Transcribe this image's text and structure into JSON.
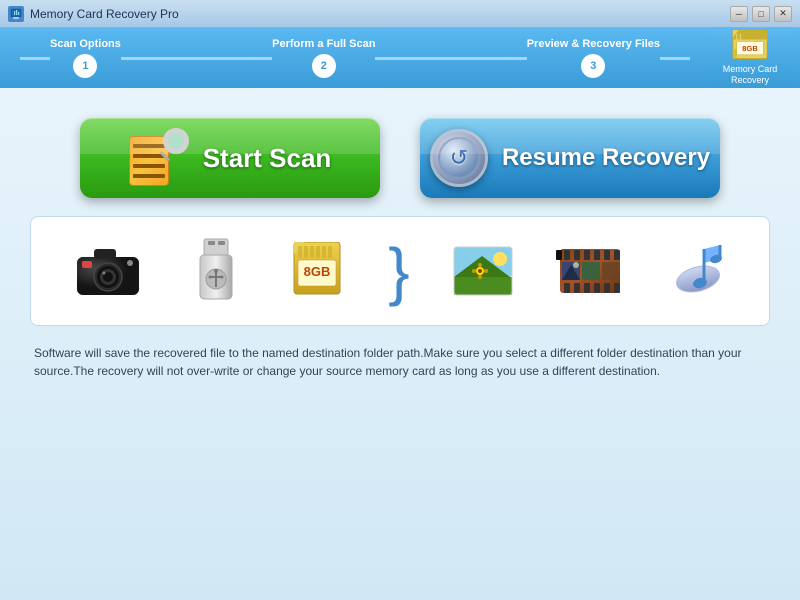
{
  "titlebar": {
    "title": "Memory Card Recovery Pro",
    "controls": {
      "minimize": "─",
      "maximize": "□",
      "close": "✕"
    }
  },
  "steps": [
    {
      "number": "1",
      "label": "Scan Options"
    },
    {
      "number": "2",
      "label": "Perform a Full Scan"
    },
    {
      "number": "3",
      "label": "Preview & Recovery Files"
    }
  ],
  "logo": {
    "line1": "Memory Card",
    "line2": "Recovery"
  },
  "buttons": {
    "start_scan": "Start Scan",
    "resume_recovery": "Resume Recovery"
  },
  "info_text": "Software will save the recovered file to the named destination folder path.Make sure you select a different folder destination than your source.The recovery will not over-write or change your source memory card as long as you use a different destination.",
  "icons": [
    "camera",
    "usb-drive",
    "sd-card",
    "brace",
    "photo",
    "film",
    "music-note"
  ]
}
